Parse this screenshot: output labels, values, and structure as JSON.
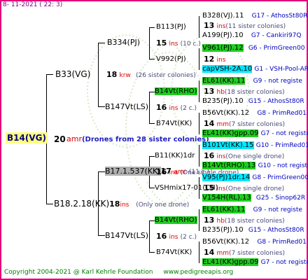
{
  "header": "8- 11-2021 ( 22: 3)",
  "footer": {
    "copyright": "Copyright 2004-2021 @ Karl Kehrle Foundation",
    "url": "www.pedigreeapis.org"
  },
  "root": {
    "id": "B14(VG)",
    "count": "20",
    "tag": "amr",
    "note": "(Drones from 28 sister colonies)"
  },
  "gen1": [
    {
      "id": "B33(VG)"
    },
    {
      "id": "B18.2.18(KK)",
      "count": "18",
      "tag": "ins",
      "note": "(Only one drone)"
    }
  ],
  "gen2": [
    {
      "id": "B334(PJ)",
      "count": "18",
      "tag": "krw",
      "note": "(26 sister colonies)"
    },
    {
      "id": "B147Vt(LS)"
    },
    {
      "id": "B17.1.537(KK)",
      "count": "17",
      "tag": "amr",
      "note": "(11 c.)"
    },
    {
      "id": "B147Vt(LS)"
    }
  ],
  "gen3": [
    {
      "id": "B113(PJ)",
      "count": "15",
      "tag": "ins",
      "note": "(10 c.)"
    },
    {
      "id": "V992(PJ)"
    },
    {
      "id": "B14Vt(RHO)",
      "count": "16",
      "tag": "ins",
      "note": "(2 c.)"
    },
    {
      "id": "B74Vt(KK)"
    },
    {
      "id": "B11(KK)1dr",
      "count": "16",
      "tag": "ins",
      "note": "(One single drone)"
    },
    {
      "id": "VSHmix17-01(CH)"
    },
    {
      "id": "B14Vt(RHO)",
      "count": "16",
      "tag": "ins",
      "note": "(2 c.)"
    },
    {
      "id": "B74Vt(KK)"
    }
  ],
  "gen4": [
    {
      "id": "B328(VJ).11",
      "code": "G17 - AthosSt80R"
    },
    {
      "count": "13",
      "tag": "ins",
      "note": "(11 sister colonies)"
    },
    {
      "id": "A199(PJ).10",
      "code": "G7 - Cankiri97Q"
    },
    {
      "id": "V961(PJ).12",
      "code": "G6 - PrimGreen00"
    },
    {
      "count": "12",
      "tag": "ins"
    },
    {
      "id": "capVSH-2A.10",
      "code": "G1 - VSH-Pool-AR"
    },
    {
      "id": "EL61(KK).11",
      "code": "G9 - not registe"
    },
    {
      "count": "13",
      "tag": "hb",
      "note": "(18 sister colonies)"
    },
    {
      "id": "B235(PJ).10",
      "code": "G15 - AthosSt80R"
    },
    {
      "id": "B56Vt(KK).12",
      "code": "G8 - PrimRed01"
    },
    {
      "count": "14",
      "tag": "mm",
      "note": "(7 sister colonies)"
    },
    {
      "id": "EL41(KK)gpp.09",
      "code": "G7 - not registe"
    },
    {
      "id": "B101Vt(KK).15",
      "code": "G10 - PrimRed01"
    },
    {
      "count": "16",
      "tag": "ins",
      "note": "(One single drone)"
    },
    {
      "id": "B14Vt(RHO).13",
      "code": "G10 - not registe"
    },
    {
      "id": "V95(PJ)1dr.14",
      "code": "G8 - PrimGreen00"
    },
    {
      "count": "15",
      "tag": "ins",
      "note": "(One single drone)"
    },
    {
      "id": "V154H(RL).13",
      "code": "G25 - Sinop62R"
    },
    {
      "id": "EL61(KK).11",
      "code": "G9 - not registe"
    },
    {
      "count": "13",
      "tag": "hb",
      "note": "(18 sister colonies)"
    },
    {
      "id": "B235(PJ).10",
      "code": "G15 - AthosSt80R"
    },
    {
      "id": "B56Vt(KK).12",
      "code": "G8 - PrimRed01"
    },
    {
      "count": "14",
      "tag": "mm",
      "note": "(7 sister colonies)"
    },
    {
      "id": "EL41(KK)gpp.09",
      "code": "G7 - not registe"
    }
  ]
}
